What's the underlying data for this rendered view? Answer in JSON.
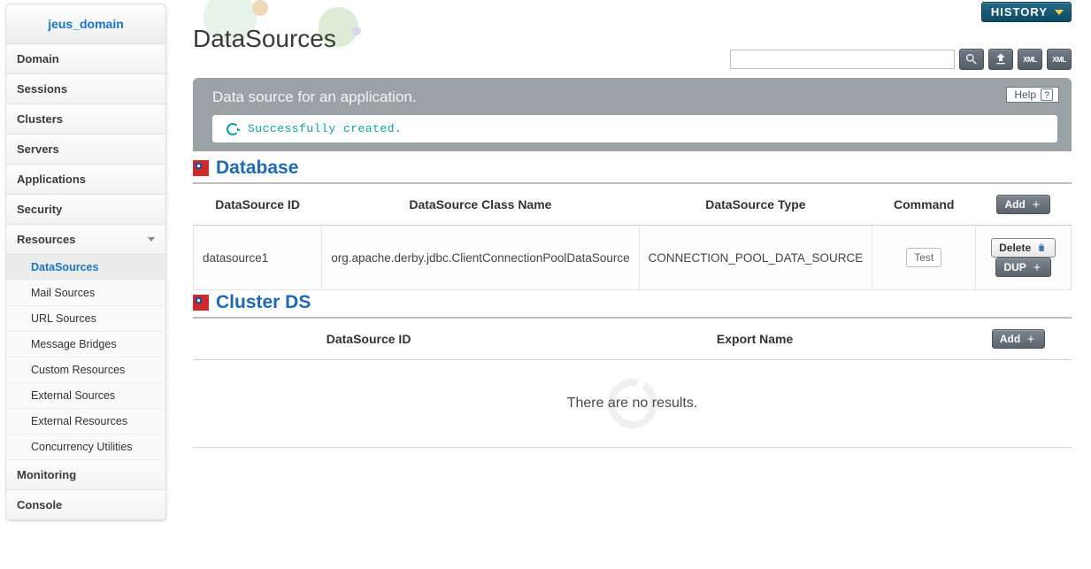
{
  "sidebar": {
    "domain": "jeus_domain",
    "items": [
      {
        "label": "Domain"
      },
      {
        "label": "Sessions"
      },
      {
        "label": "Clusters"
      },
      {
        "label": "Servers"
      },
      {
        "label": "Applications"
      },
      {
        "label": "Security"
      },
      {
        "label": "Resources",
        "expandable": true,
        "expanded": true,
        "children": [
          {
            "label": "DataSources",
            "selected": true
          },
          {
            "label": "Mail Sources"
          },
          {
            "label": "URL Sources"
          },
          {
            "label": "Message Bridges"
          },
          {
            "label": "Custom Resources"
          },
          {
            "label": "External Sources"
          },
          {
            "label": "External Resources"
          },
          {
            "label": "Concurrency Utilities"
          }
        ]
      },
      {
        "label": "Monitoring"
      },
      {
        "label": "Console"
      }
    ]
  },
  "header": {
    "history_label": "HISTORY",
    "page_title": "DataSources",
    "search_placeholder": ""
  },
  "panel": {
    "subtitle": "Data source for an application.",
    "help_label": "Help",
    "message": "Successfully created."
  },
  "sections": {
    "database": {
      "title": "Database",
      "columns": [
        "DataSource ID",
        "DataSource Class Name",
        "DataSource Type",
        "Command"
      ],
      "add_label": "Add",
      "rows": [
        {
          "id": "datasource1",
          "class_name": "org.apache.derby.jdbc.ClientConnectionPoolDataSource",
          "type": "CONNECTION_POOL_DATA_SOURCE",
          "command_label": "Test",
          "delete_label": "Delete",
          "dup_label": "DUP"
        }
      ]
    },
    "cluster": {
      "title": "Cluster DS",
      "columns": [
        "DataSource ID",
        "Export Name"
      ],
      "add_label": "Add",
      "empty_message": "There are no results."
    }
  }
}
